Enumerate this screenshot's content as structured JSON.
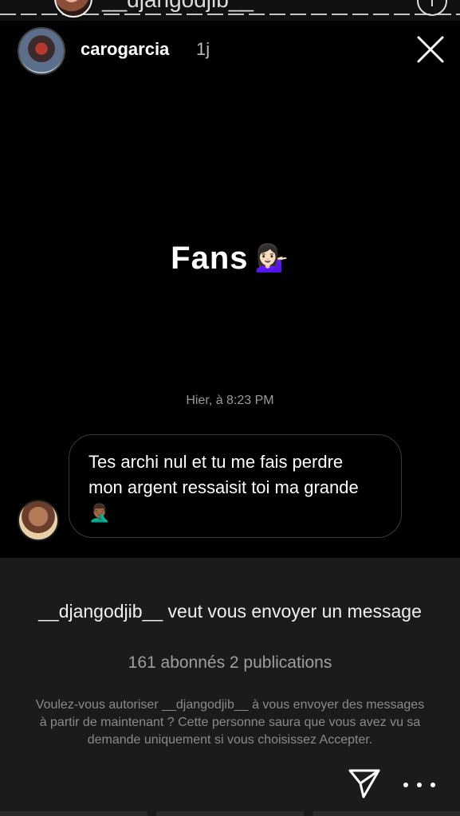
{
  "top_overlay": {
    "username_cut": "__djangodjib__",
    "info_icon": "info-icon"
  },
  "story": {
    "username": "carogarcia",
    "age": "1j",
    "close_icon": "close-icon"
  },
  "content": {
    "title": "Fans",
    "title_emoji": "💁🏻‍♀️"
  },
  "message": {
    "timestamp": "Hier, à 8:23 PM",
    "text": "Tes archi nul et tu me fais perdre mon argent ressaisit toi ma grande 🤦🏾‍♂️"
  },
  "request_panel": {
    "request_text": "__djangodjib__ veut vous envoyer un message",
    "stats": "161 abonnés 2 publications",
    "explanation": "Voulez-vous autoriser __djangodjib__ à vous envoyer des messages à partir de maintenant ? Cette personne saura que vous avez vu sa demande uniquement si vous choisissez Accepter."
  },
  "footer": {
    "send_icon": "send-icon",
    "more_icon": "more-icon"
  },
  "colors": {
    "background": "#000000",
    "panel": "#1b1b1b",
    "muted_text": "#9e9e9e"
  }
}
